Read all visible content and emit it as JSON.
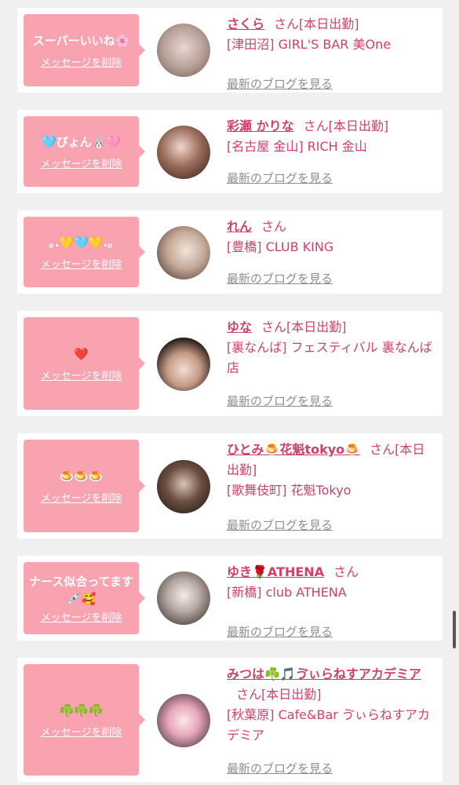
{
  "delete_label": "メッセージを削除",
  "blog_label": "最新のブログを見る",
  "san_suffix": "さん",
  "colors": {
    "pink_bubble": "#f9a3b1",
    "name_pink": "#d23f69",
    "link_gray": "#8e8e8e"
  },
  "entries": [
    {
      "message": "スーパーいいね🌸",
      "name": "さくら",
      "working": "[本日出勤]",
      "shop": "[津田沼] GIRL'S BAR 美One"
    },
    {
      "message": "🩵ぴょん🐰🩷",
      "name": "彩瀬 かりな",
      "working": "[本日出勤]",
      "shop": "[名古屋 金山] RICH 金山"
    },
    {
      "message": "｡.💛🩵💛.｡",
      "name": "れん",
      "working": "",
      "shop": "[豊橋] CLUB KING"
    },
    {
      "message": "❤️",
      "name": "ゆな",
      "working": "[本日出勤]",
      "shop": "[裏なんば] フェスティバル 裏なんば店"
    },
    {
      "message": "🍮🍮🍮",
      "name": "ひとみ🍮花魁tokyo🍮",
      "working": "[本日出勤]",
      "shop": "[歌舞伎町] 花魁Tokyo"
    },
    {
      "message": "ナース似合ってます💉🥰",
      "name": "ゆき🌹ATHENA",
      "working": "",
      "shop": "[新橋] club ATHENA"
    },
    {
      "message": "☘️☘️☘️",
      "name": "みつは☘️🎵ゔぃらねすアカデミア",
      "working": "[本日出勤]",
      "shop": "[秋葉原] Cafe&Bar ゔぃらねすアカデミア"
    }
  ]
}
